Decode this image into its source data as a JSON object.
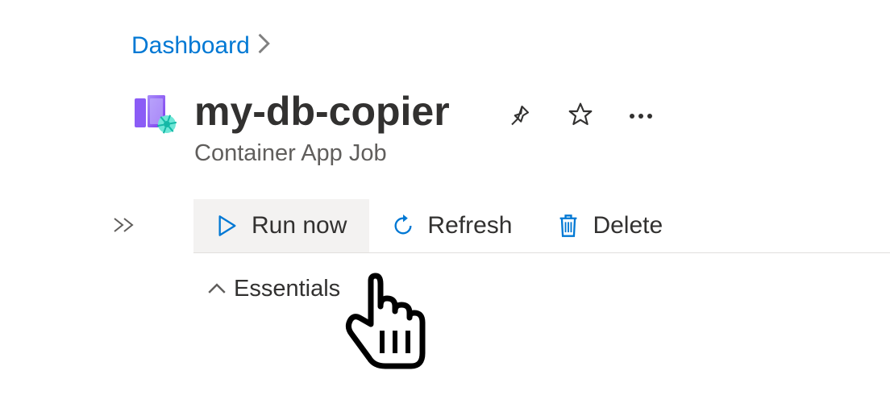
{
  "breadcrumb": {
    "parent": "Dashboard"
  },
  "resource": {
    "title": "my-db-copier",
    "subtitle": "Container App Job"
  },
  "toolbar": {
    "run_now": "Run now",
    "refresh": "Refresh",
    "delete": "Delete"
  },
  "sections": {
    "essentials": "Essentials"
  },
  "colors": {
    "link": "#0078d4",
    "accent": "#0078d4"
  }
}
